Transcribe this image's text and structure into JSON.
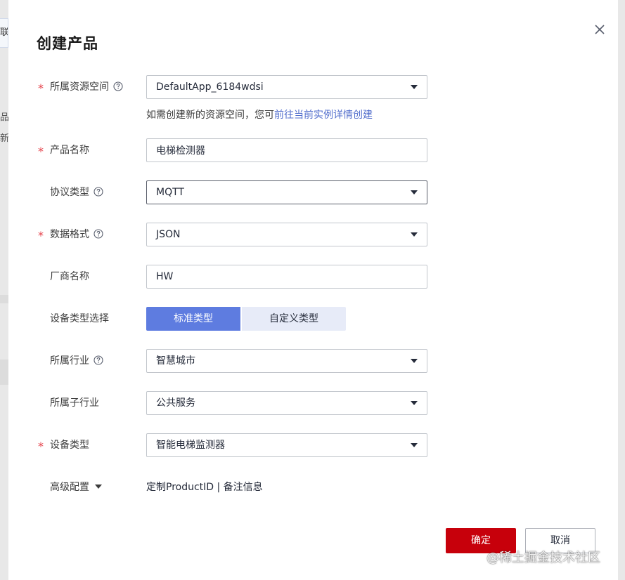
{
  "background": {
    "tab_text": "联",
    "chars": [
      "品",
      "新"
    ]
  },
  "dialog": {
    "title": "创建产品",
    "required_mark": "*",
    "space": {
      "label": "所属资源空间",
      "value": "DefaultApp_6184wdsi",
      "hint_prefix": "如需创建新的资源空间，您可",
      "hint_link": "前往当前实例详情创建"
    },
    "product_name": {
      "label": "产品名称",
      "value": "电梯检测器"
    },
    "protocol": {
      "label": "协议类型",
      "value": "MQTT"
    },
    "data_format": {
      "label": "数据格式",
      "value": "JSON"
    },
    "vendor": {
      "label": "厂商名称",
      "value": "HW"
    },
    "device_type_select": {
      "label": "设备类型选择",
      "options": [
        "标准类型",
        "自定义类型"
      ],
      "selected": "标准类型"
    },
    "industry": {
      "label": "所属行业",
      "value": "智慧城市"
    },
    "sub_industry": {
      "label": "所属子行业",
      "value": "公共服务"
    },
    "device_type": {
      "label": "设备类型",
      "value": "智能电梯监测器"
    },
    "advanced": {
      "label": "高级配置",
      "value": "定制ProductID | 备注信息"
    },
    "buttons": {
      "ok": "确定",
      "cancel": "取消"
    }
  },
  "watermark": "@稀土掘金技术社区",
  "colors": {
    "primary": "#5e7ce0",
    "danger": "#c7000b",
    "link": "#526ecc",
    "required": "#e5424b"
  },
  "icons": {
    "help": "question-circle-icon",
    "close": "close-icon",
    "dropdown": "caret-down-icon"
  }
}
